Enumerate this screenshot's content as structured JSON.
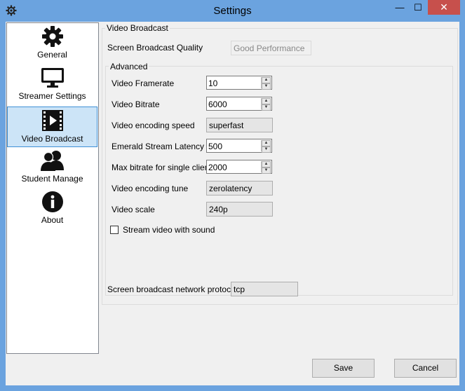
{
  "window": {
    "title": "Settings",
    "controls": {
      "minimize": "—",
      "maximize": "☐",
      "close": "✕"
    }
  },
  "sidebar": {
    "items": [
      {
        "label": "General",
        "icon": "gear-icon",
        "selected": false
      },
      {
        "label": "Streamer Settings",
        "icon": "monitor-icon",
        "selected": false
      },
      {
        "label": "Video Broadcast",
        "icon": "film-icon",
        "selected": true
      },
      {
        "label": "Student Manage",
        "icon": "users-icon",
        "selected": false
      },
      {
        "label": "About",
        "icon": "info-icon",
        "selected": false
      }
    ]
  },
  "video_broadcast": {
    "group_title": "Video Broadcast",
    "quality_label": "Screen Broadcast Quality",
    "quality_value": "Good Performance",
    "advanced": {
      "group_title": "Advanced",
      "framerate_label": "Video Framerate",
      "framerate_value": "10",
      "bitrate_label": "Video Bitrate",
      "bitrate_value": "6000",
      "encoding_speed_label": "Video encoding speed",
      "encoding_speed_value": "superfast",
      "latency_label": "Emerald Stream Latency",
      "latency_value": "500",
      "max_bitrate_label": "Max bitrate for single client",
      "max_bitrate_value": "2000",
      "encoding_tune_label": "Video encoding tune",
      "encoding_tune_value": "zerolatency",
      "scale_label": "Video scale",
      "scale_value": "240p",
      "sound_label": "Stream video with sound",
      "sound_checked": false
    },
    "protocol_label": "Screen broadcast network protocol",
    "protocol_value": "tcp"
  },
  "footer": {
    "save_label": "Save",
    "cancel_label": "Cancel"
  },
  "colors": {
    "frame": "#6ba3df",
    "selected_bg": "#cce4f7",
    "selected_border": "#3f90d6",
    "close_button": "#c7504c"
  }
}
